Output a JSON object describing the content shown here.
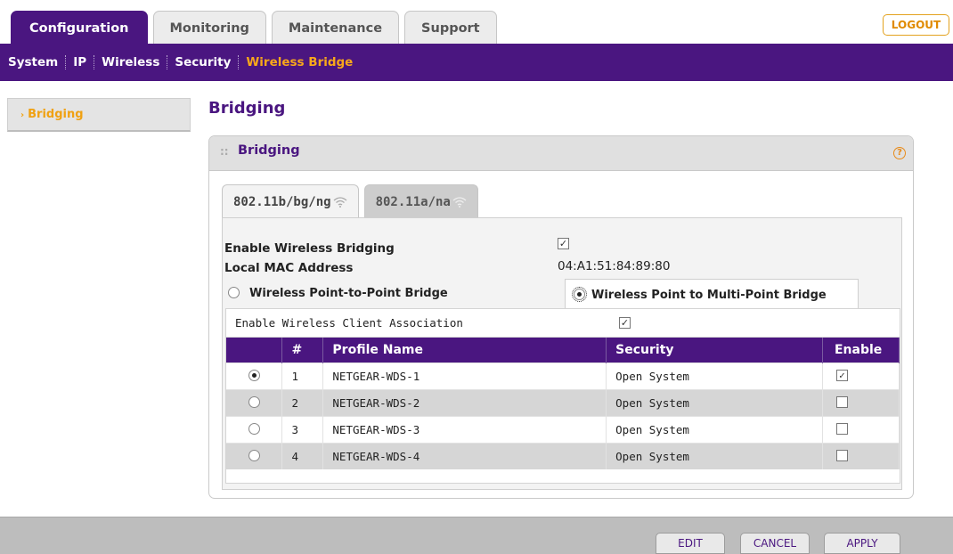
{
  "top_tabs": [
    {
      "label": "Configuration",
      "active": true
    },
    {
      "label": "Monitoring",
      "active": false
    },
    {
      "label": "Maintenance",
      "active": false
    },
    {
      "label": "Support",
      "active": false
    }
  ],
  "logout_label": "LOGOUT",
  "subnav": [
    {
      "label": "System",
      "active": false
    },
    {
      "label": "IP",
      "active": false
    },
    {
      "label": "Wireless",
      "active": false
    },
    {
      "label": "Security",
      "active": false
    },
    {
      "label": "Wireless Bridge",
      "active": true
    }
  ],
  "sidebar": {
    "items": [
      {
        "label": "Bridging",
        "active": true
      }
    ]
  },
  "page_title": "Bridging",
  "panel": {
    "title": "Bridging",
    "help_icon": "?",
    "band_tabs": [
      {
        "label": "802.11b/bg/ng",
        "active": true
      },
      {
        "label": "802.11a/na",
        "active": false
      }
    ],
    "enable_bridging_label": "Enable Wireless Bridging",
    "enable_bridging_checked": true,
    "local_mac_label": "Local MAC Address",
    "local_mac_value": "04:A1:51:84:89:80",
    "mode_p2p_label": "Wireless Point-to-Point Bridge",
    "mode_p2mp_label": "Wireless Point to Multi-Point Bridge",
    "selected_mode": "p2mp",
    "client_assoc_label": "Enable Wireless Client Association",
    "client_assoc_checked": true,
    "table": {
      "headers": [
        "#",
        "Profile Name",
        "Security",
        "Enable"
      ],
      "rows": [
        {
          "selected": true,
          "num": "1",
          "profile": "NETGEAR-WDS-1",
          "security": "Open System",
          "enabled": true
        },
        {
          "selected": false,
          "num": "2",
          "profile": "NETGEAR-WDS-2",
          "security": "Open System",
          "enabled": false
        },
        {
          "selected": false,
          "num": "3",
          "profile": "NETGEAR-WDS-3",
          "security": "Open System",
          "enabled": false
        },
        {
          "selected": false,
          "num": "4",
          "profile": "NETGEAR-WDS-4",
          "security": "Open System",
          "enabled": false
        }
      ]
    }
  },
  "footer_buttons": {
    "edit": "EDIT",
    "cancel": "CANCEL",
    "apply": "APPLY"
  },
  "colors": {
    "brand_purple": "#4a1680",
    "accent_orange": "#f9a81a"
  }
}
